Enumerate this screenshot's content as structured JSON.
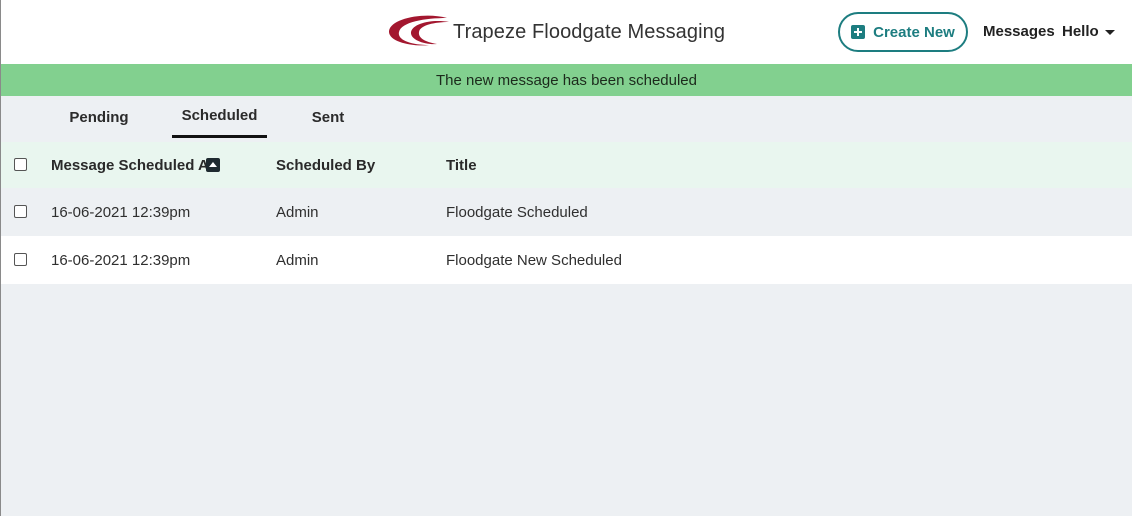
{
  "header": {
    "app_title": "Trapeze Floodgate Messaging",
    "logo_icon": "trapeze-logo-swoosh",
    "create_button_label": "Create New",
    "create_icon": "plus-square-icon",
    "nav_messages": "Messages",
    "nav_user": "Hello",
    "user_menu_icon": "caret-down-icon"
  },
  "alert": {
    "message": "The new message has been scheduled",
    "color": "#82d08f"
  },
  "tabs": [
    {
      "label": "Pending",
      "active": false
    },
    {
      "label": "Scheduled",
      "active": true
    },
    {
      "label": "Sent",
      "active": false
    }
  ],
  "table": {
    "columns": [
      {
        "label": "Message Scheduled At",
        "sort": "ascending"
      },
      {
        "label": "Scheduled By"
      },
      {
        "label": "Title"
      }
    ],
    "rows": [
      {
        "scheduled_at": "16-06-2021 12:39pm",
        "scheduled_by": "Admin",
        "title": "Floodgate Scheduled"
      },
      {
        "scheduled_at": "16-06-2021 12:39pm",
        "scheduled_by": "Admin",
        "title": "Floodgate New Scheduled"
      }
    ]
  },
  "colors": {
    "accent": "#1d7d80",
    "brand_red": "#a3172f",
    "header_row_bg": "#e9f6ef",
    "page_bg": "#edf0f3"
  }
}
